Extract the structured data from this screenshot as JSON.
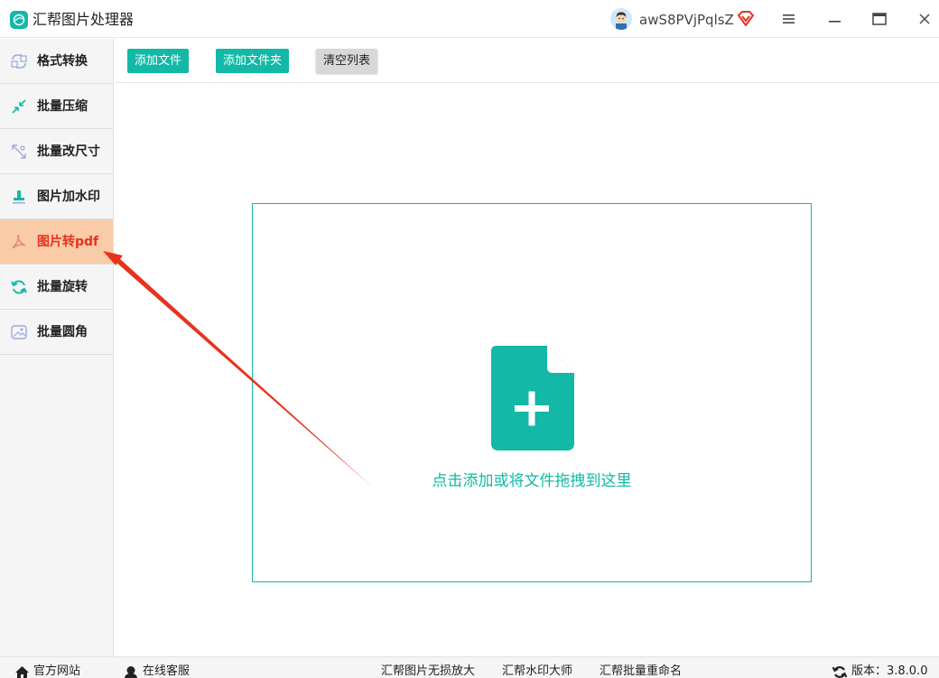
{
  "app": {
    "title": "汇帮图片处理器",
    "username": "awS8PVjPqlsZ",
    "accent_color": "#13b8a6",
    "active_color": "#e8321e",
    "active_bg": "#f9cba6"
  },
  "window_controls": {
    "menu_icon": "hamburger-icon",
    "minimize_icon": "minimize-icon",
    "maximize_icon": "maximize-icon",
    "close_icon": "close-icon"
  },
  "sidebar": {
    "items": [
      {
        "label": "格式转换",
        "icon": "format-convert-icon",
        "active": false
      },
      {
        "label": "批量压缩",
        "icon": "compress-icon",
        "active": false
      },
      {
        "label": "批量改尺寸",
        "icon": "resize-icon",
        "active": false
      },
      {
        "label": "图片加水印",
        "icon": "watermark-icon",
        "active": false
      },
      {
        "label": "图片转pdf",
        "icon": "pdf-icon",
        "active": true
      },
      {
        "label": "批量旋转",
        "icon": "rotate-icon",
        "active": false
      },
      {
        "label": "批量圆角",
        "icon": "round-corner-icon",
        "active": false
      }
    ]
  },
  "toolbar": {
    "add_file": "添加文件",
    "add_folder": "添加文件夹",
    "clear_list": "清空列表"
  },
  "dropzone": {
    "icon": "add-file-icon",
    "text": "点击添加或将文件拖拽到这里"
  },
  "statusbar": {
    "website": "官方网站",
    "support": "在线客服",
    "link1": "汇帮图片无损放大",
    "link2": "汇帮水印大师",
    "link3": "汇帮批量重命名",
    "version_label": "版本：3.8.0.0"
  }
}
